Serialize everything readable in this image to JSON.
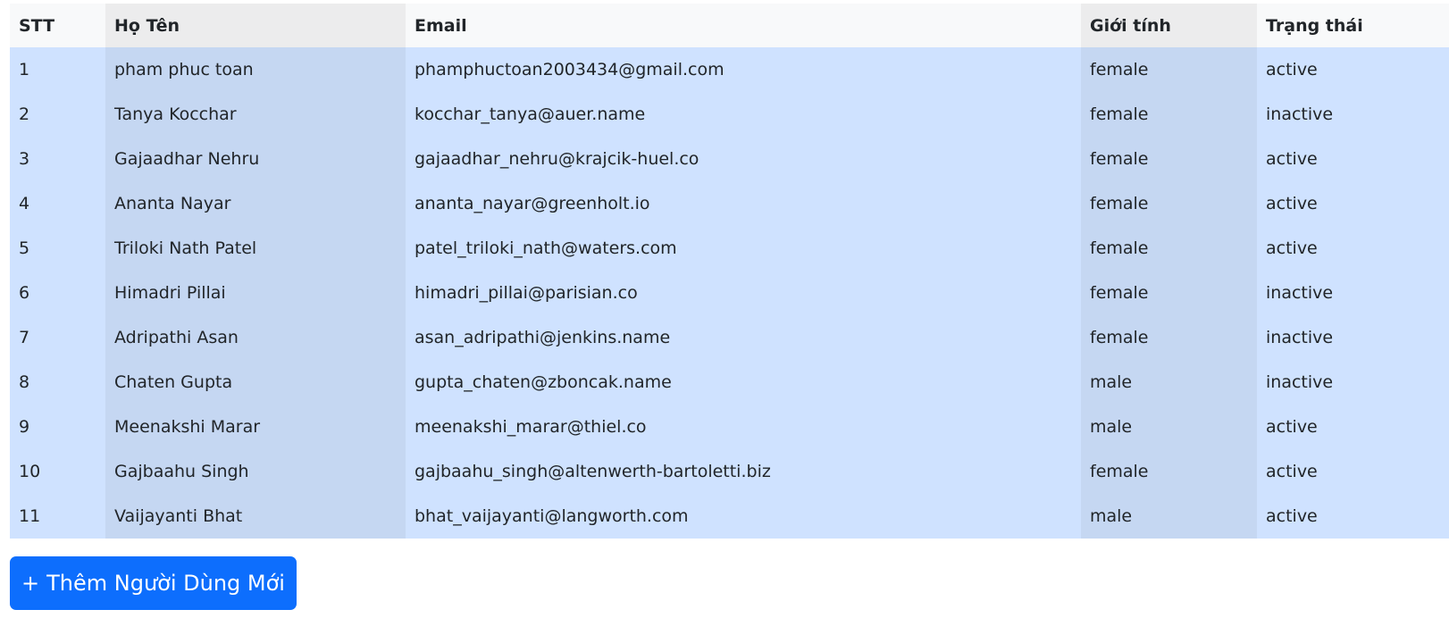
{
  "table": {
    "headers": {
      "stt": "STT",
      "name": "Họ Tên",
      "email": "Email",
      "gender": "Giới tính",
      "status": "Trạng thái"
    },
    "rows": [
      {
        "stt": "1",
        "name": "pham phuc toan",
        "email": "phamphuctoan2003434@gmail.com",
        "gender": "female",
        "status": "active"
      },
      {
        "stt": "2",
        "name": "Tanya Kocchar",
        "email": "kocchar_tanya@auer.name",
        "gender": "female",
        "status": "inactive"
      },
      {
        "stt": "3",
        "name": "Gajaadhar Nehru",
        "email": "gajaadhar_nehru@krajcik-huel.co",
        "gender": "female",
        "status": "active"
      },
      {
        "stt": "4",
        "name": "Ananta Nayar",
        "email": "ananta_nayar@greenholt.io",
        "gender": "female",
        "status": "active"
      },
      {
        "stt": "5",
        "name": "Triloki Nath Patel",
        "email": "patel_triloki_nath@waters.com",
        "gender": "female",
        "status": "active"
      },
      {
        "stt": "6",
        "name": "Himadri Pillai",
        "email": "himadri_pillai@parisian.co",
        "gender": "female",
        "status": "inactive"
      },
      {
        "stt": "7",
        "name": "Adripathi Asan",
        "email": "asan_adripathi@jenkins.name",
        "gender": "female",
        "status": "inactive"
      },
      {
        "stt": "8",
        "name": "Chaten Gupta",
        "email": "gupta_chaten@zboncak.name",
        "gender": "male",
        "status": "inactive"
      },
      {
        "stt": "9",
        "name": "Meenakshi Marar",
        "email": "meenakshi_marar@thiel.co",
        "gender": "male",
        "status": "active"
      },
      {
        "stt": "10",
        "name": "Gajbaahu Singh",
        "email": "gajbaahu_singh@altenwerth-bartoletti.biz",
        "gender": "female",
        "status": "active"
      },
      {
        "stt": "11",
        "name": "Vaijayanti Bhat",
        "email": "bhat_vaijayanti@langworth.com",
        "gender": "male",
        "status": "active"
      }
    ]
  },
  "actions": {
    "add_user_plus": "+",
    "add_user_label": "Thêm Người Dùng Mới"
  },
  "colors": {
    "row_bg": "#cfe2ff",
    "row_bg_alt_col": "#c5d7f2",
    "header_bg": "#f8f9fa",
    "header_bg_alt_col": "#ececed",
    "button_bg": "#0d6efd"
  }
}
